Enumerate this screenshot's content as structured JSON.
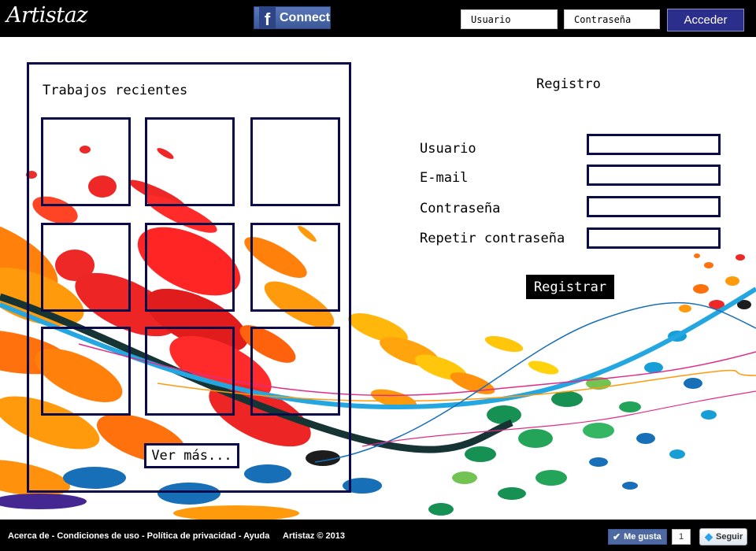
{
  "header": {
    "logo": "Artistaz",
    "facebook": {
      "icon": "f",
      "label": "Connect"
    },
    "username_placeholder": "Usuario",
    "password_placeholder": "Contraseña",
    "login_label": "Acceder"
  },
  "recent": {
    "title": "Trabajos recientes",
    "more_label": "Ver más..."
  },
  "register": {
    "title": "Registro",
    "fields": [
      "Usuario",
      "E-mail",
      "Contraseña",
      "Repetir contraseña"
    ],
    "submit_label": "Registrar"
  },
  "footer": {
    "links": [
      "Acerca de",
      "Condiciones de uso",
      "Política de privacidad",
      "Ayuda"
    ],
    "separator": " - ",
    "copyright": "Artistaz © 2013",
    "like_label": "Me gusta",
    "like_count": "1",
    "follow_label": "Seguir"
  },
  "colors": {
    "panel_border": "#0b0b4b",
    "facebook_blue": "#3b5998",
    "login_button": "#2c2e8c"
  }
}
